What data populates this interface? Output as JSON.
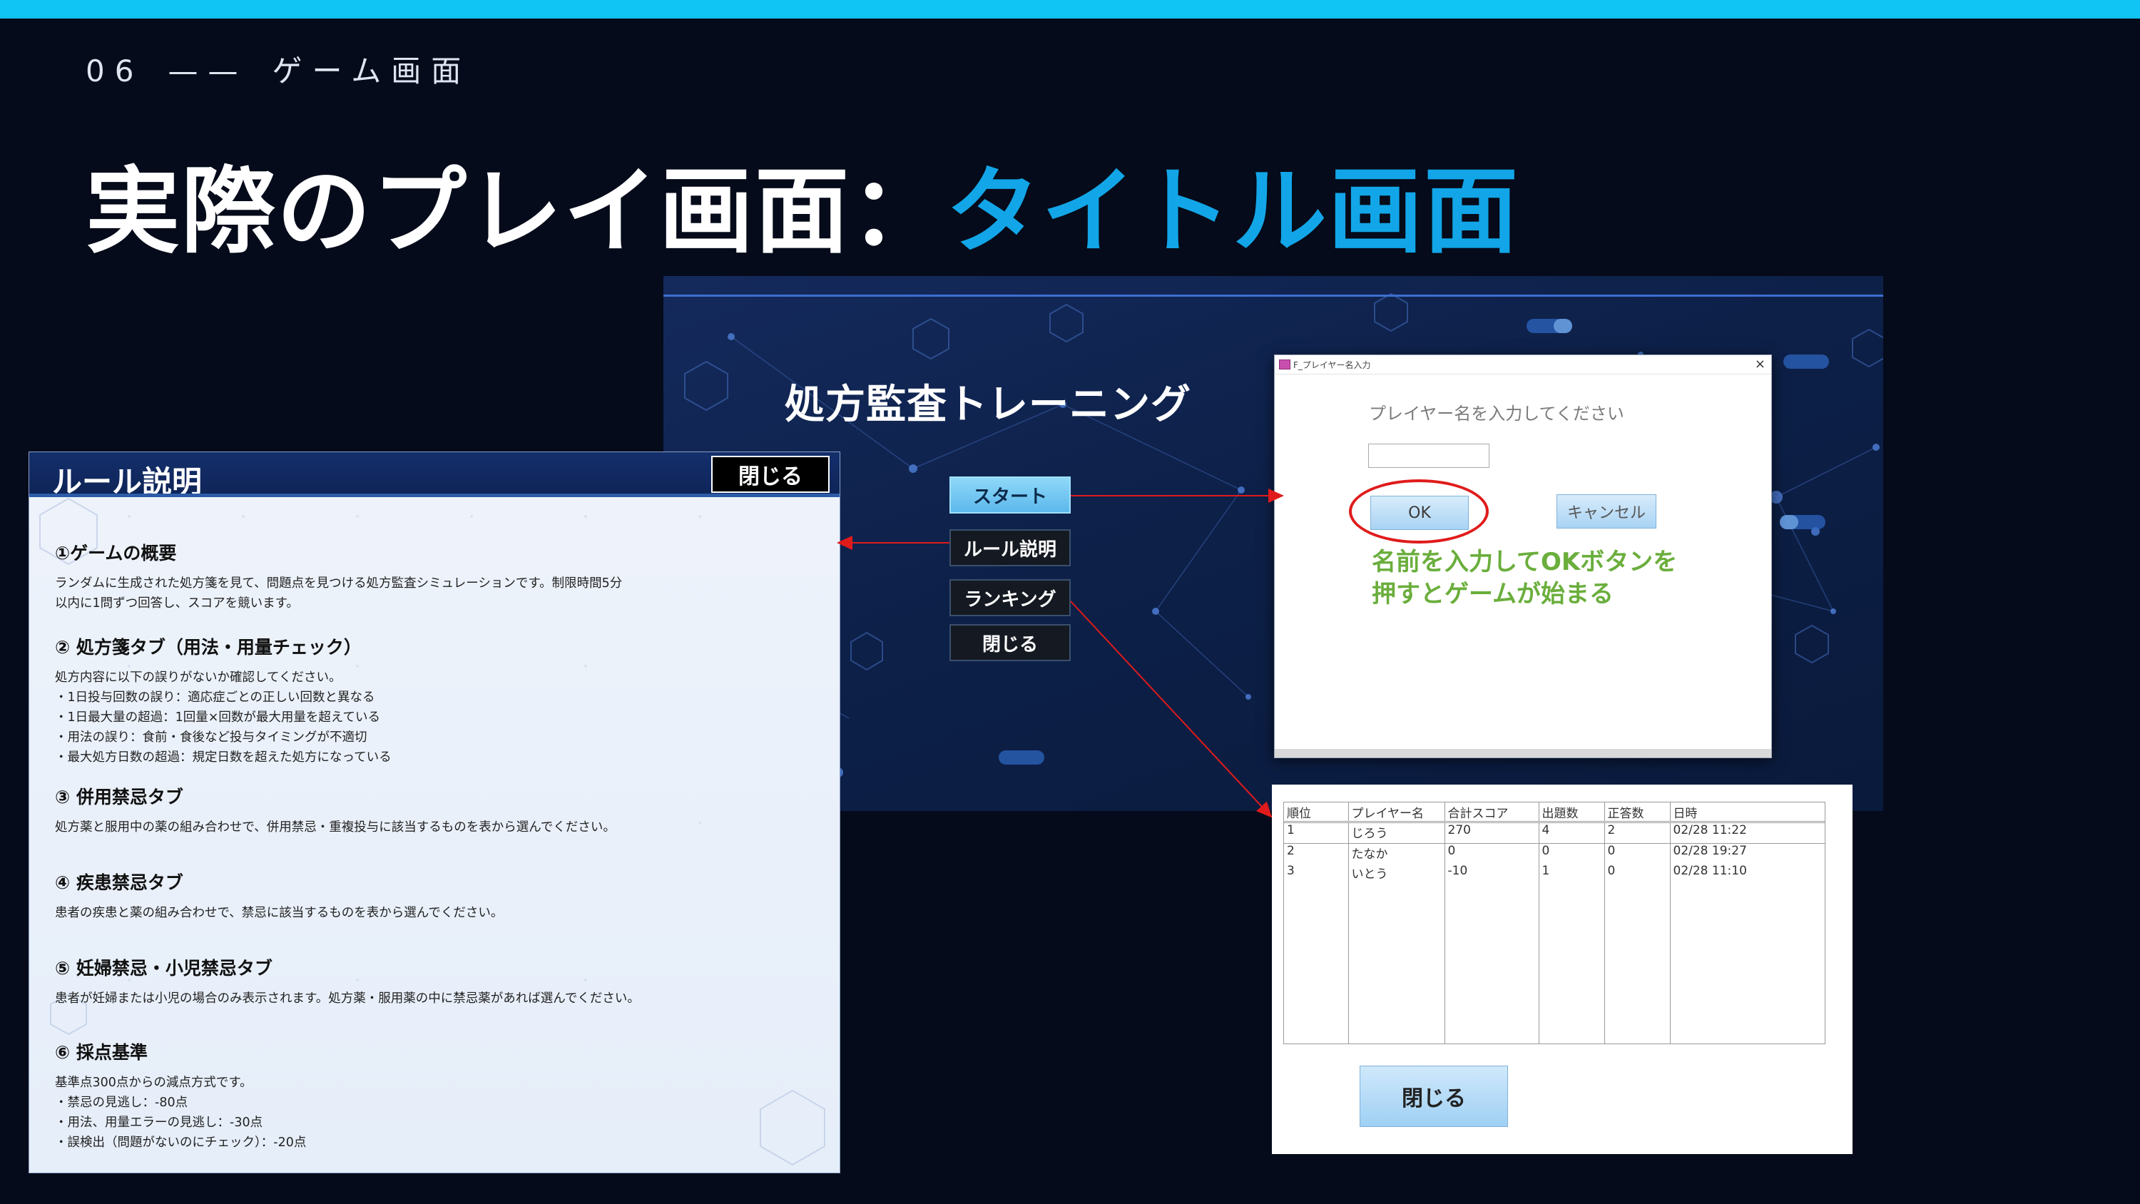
{
  "slide": {
    "number": "06",
    "dash": "——",
    "section": "ゲーム画面",
    "title_main": "実際のプレイ画面：",
    "title_accent": "タイトル画面",
    "accent_color": "#12a6e8",
    "topbar_color": "#10c4f4"
  },
  "title_screen": {
    "app_title": "処方監査トレーニング",
    "menu": {
      "start": "スタート",
      "rules": "ルール説明",
      "ranking": "ランキング",
      "close": "閉じる"
    }
  },
  "name_dialog": {
    "caption": "F_プレイヤー名入力",
    "close_glyph": "×",
    "prompt": "プレイヤー名を入力してください",
    "input_value": "",
    "ok_label": "OK",
    "cancel_label": "キャンセル",
    "annotation_line1": "名前を入力してOKボタンを",
    "annotation_line2": "押すとゲームが始まる",
    "annotation_color": "#6aae3c",
    "highlight_color": "#e01b1b"
  },
  "rules_panel": {
    "title": "ルール説明",
    "close_label": "閉じる",
    "sections": [
      {
        "heading": "①ゲームの概要",
        "lines": [
          "ランダムに生成された処方箋を見て、問題点を見つける処方監査シミュレーションです。制限時間5分",
          "以内に1問ずつ回答し、スコアを競います。"
        ]
      },
      {
        "heading": "② 処方箋タブ（用法・用量チェック）",
        "lines": [
          "処方内容に以下の誤りがないか確認してください。",
          "・1日投与回数の誤り：適応症ごとの正しい回数と異なる",
          "・1日最大量の超過：1回量×回数が最大用量を超えている",
          "・用法の誤り：食前・食後など投与タイミングが不適切",
          "・最大処方日数の超過：規定日数を超えた処方になっている"
        ]
      },
      {
        "heading": "③ 併用禁忌タブ",
        "lines": [
          "処方薬と服用中の薬の組み合わせで、併用禁忌・重複投与に該当するものを表から選んでください。"
        ]
      },
      {
        "heading": "④ 疾患禁忌タブ",
        "lines": [
          "患者の疾患と薬の組み合わせで、禁忌に該当するものを表から選んでください。"
        ]
      },
      {
        "heading": "⑤ 妊婦禁忌・小児禁忌タブ",
        "lines": [
          "患者が妊婦または小児の場合のみ表示されます。処方薬・服用薬の中に禁忌薬があれば選んでください。"
        ]
      },
      {
        "heading": "⑥ 採点基準",
        "lines": [
          "基準点300点からの減点方式です。",
          "・禁忌の見逃し：-80点",
          "・用法、用量エラーの見逃し：-30点",
          "・誤検出（問題がないのにチェック）：-20点"
        ]
      }
    ]
  },
  "ranking_panel": {
    "columns": [
      "順位",
      "プレイヤー名",
      "合計スコア",
      "出題数",
      "正答数",
      "日時"
    ],
    "rows": [
      [
        "1",
        "じろう",
        "270",
        "4",
        "2",
        "02/28 11:22"
      ],
      [
        "2",
        "たなか",
        "0",
        "0",
        "0",
        "02/28 19:27"
      ],
      [
        "3",
        "いとう",
        "-10",
        "1",
        "0",
        "02/28 11:10"
      ]
    ],
    "close_label": "閉じる"
  },
  "arrow_color": "#e01b1b"
}
